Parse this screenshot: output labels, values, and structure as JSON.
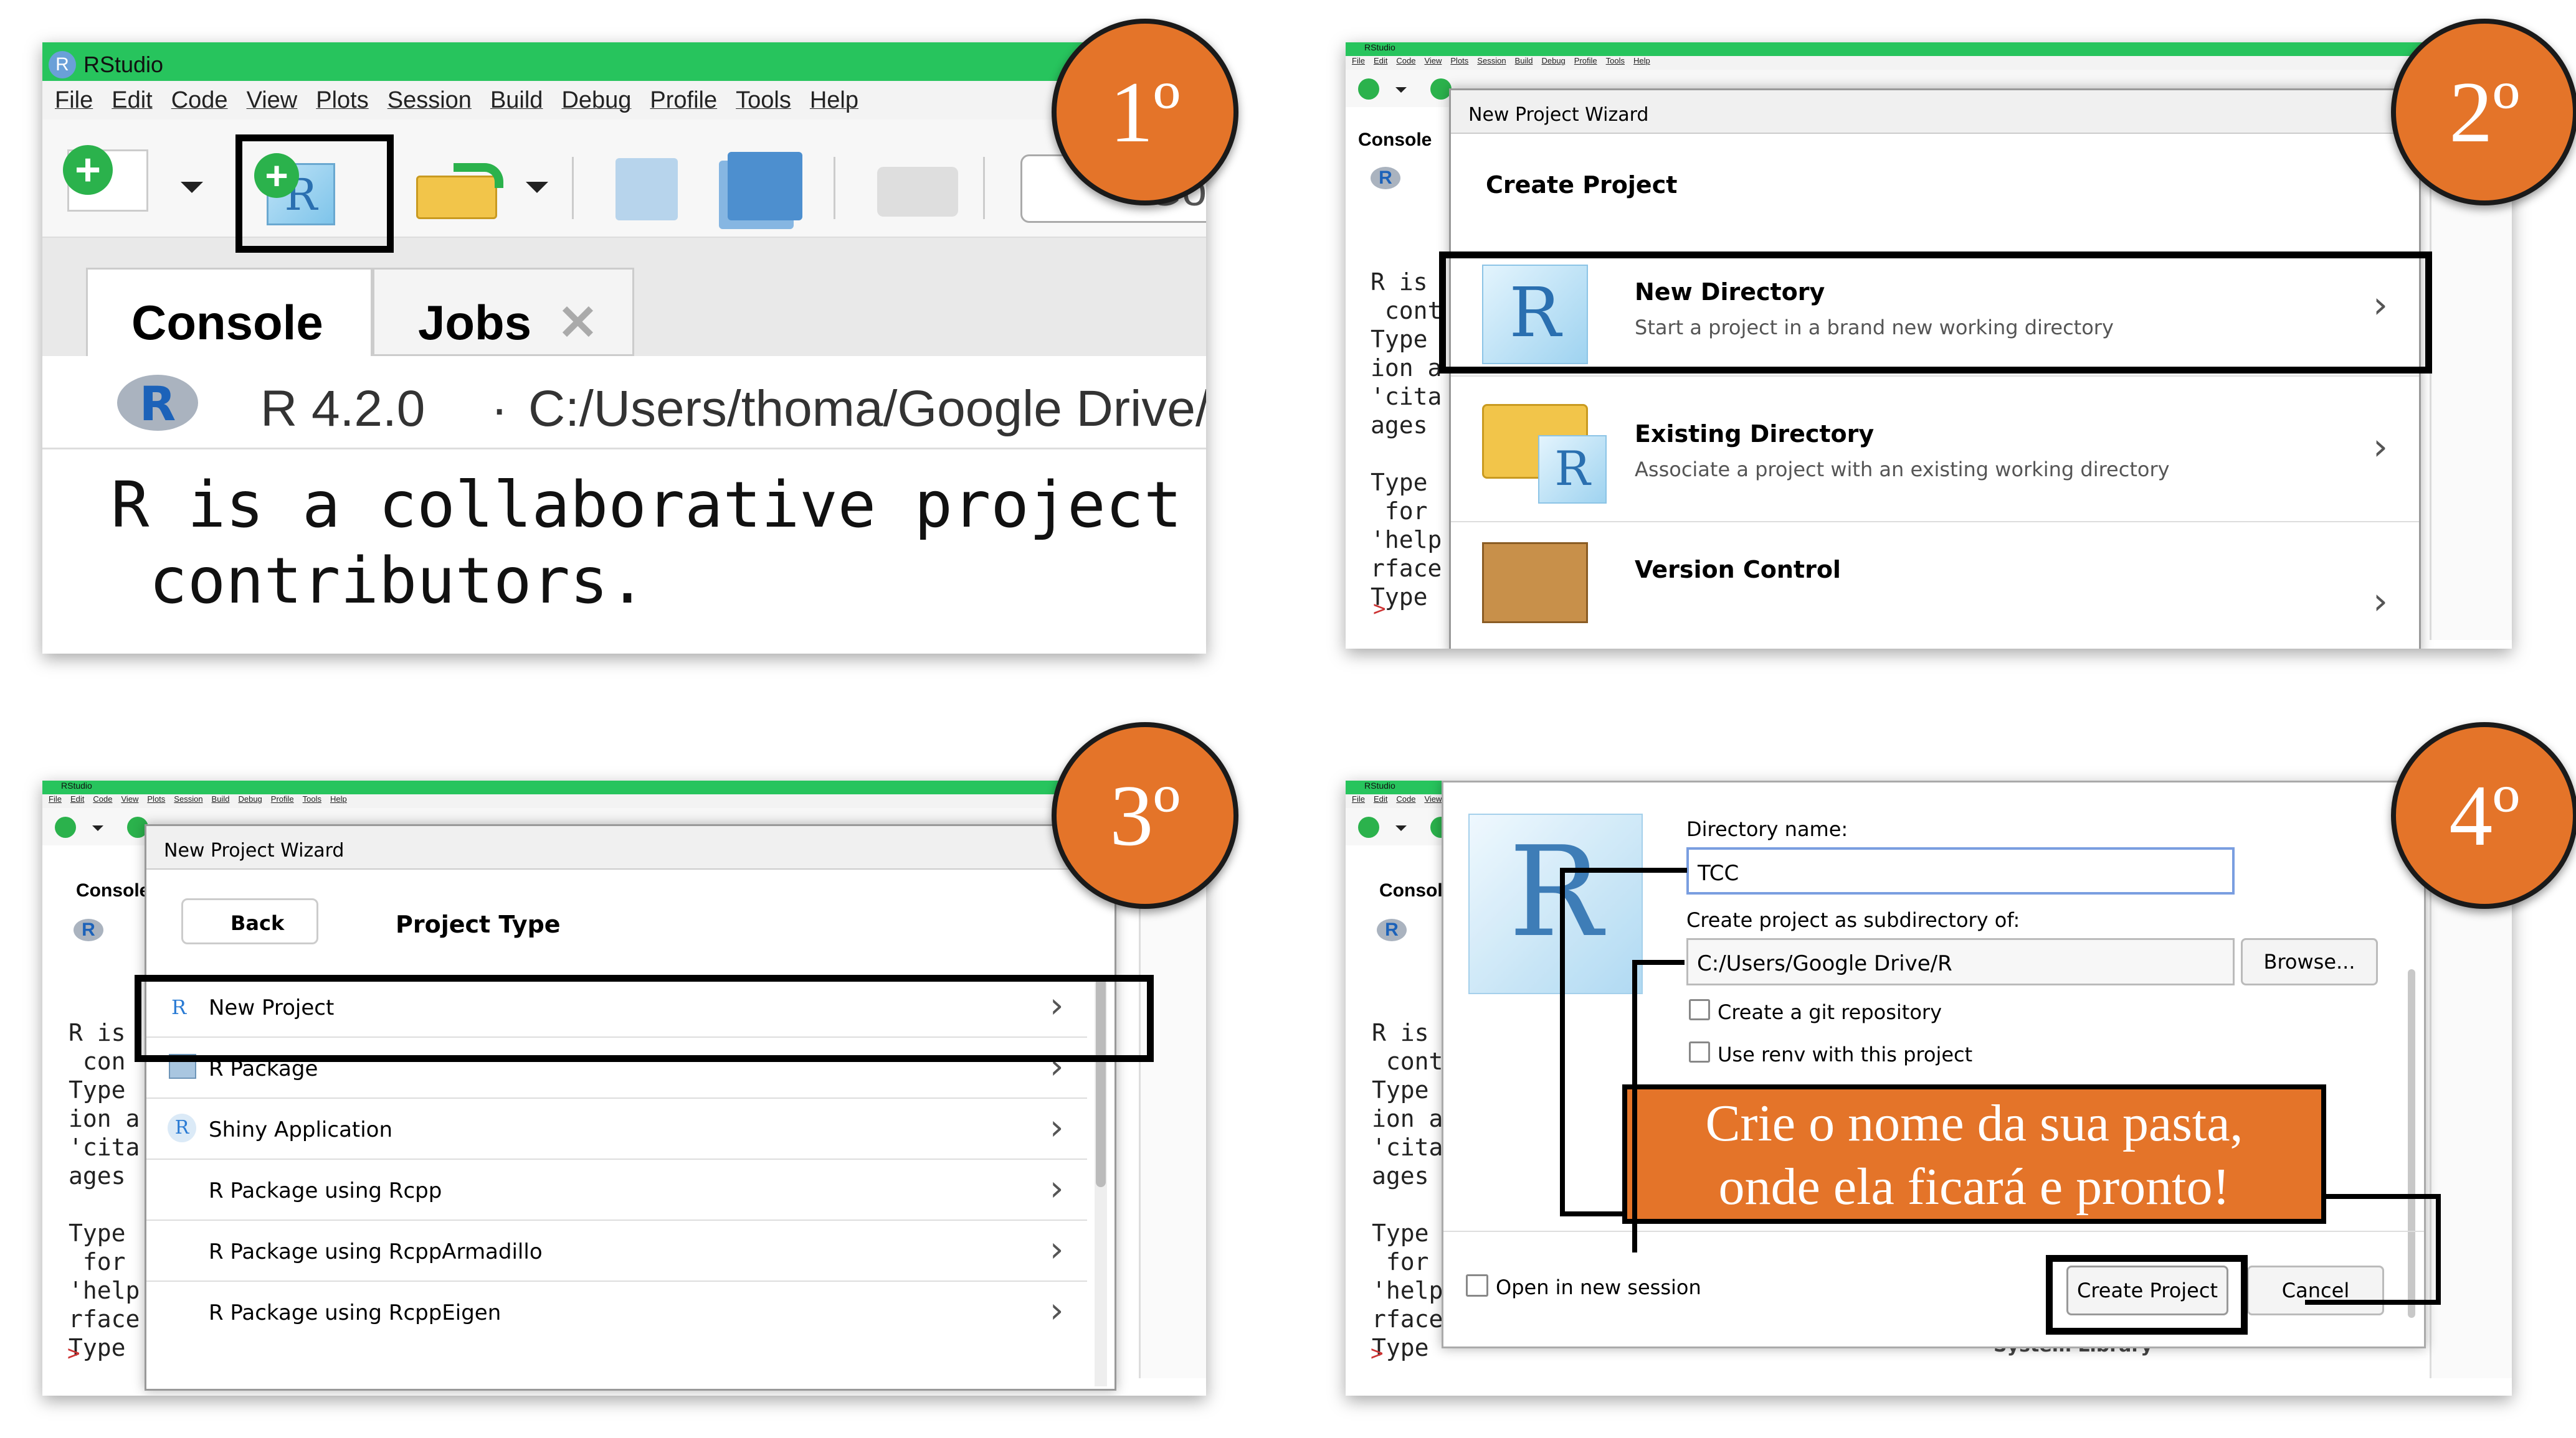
{
  "steps": [
    "1º",
    "2º",
    "3º",
    "4º"
  ],
  "app_title": "RStudio",
  "menu": [
    "File",
    "Edit",
    "Code",
    "View",
    "Plots",
    "Session",
    "Build",
    "Debug",
    "Profile",
    "Tools",
    "Help"
  ],
  "panel1": {
    "tabs": [
      "Console",
      "Jobs"
    ],
    "r_version": "R 4.2.0",
    "path": "C:/Users/thoma/Google Drive/",
    "console_line1": "R is a collaborative project",
    "console_line2": " contributors.",
    "go_fragment": "Go"
  },
  "console_bg_lines": [
    "R is",
    " cont",
    "Type",
    "ion a",
    "'cita",
    "ages",
    "",
    "Type",
    " for",
    "'help",
    "rface",
    "Type"
  ],
  "console_bg_lines_short": [
    "R is",
    " con",
    "Type",
    "ion a",
    "'cita",
    "ages",
    "",
    "Type",
    " for",
    "'help",
    "rface",
    "Type"
  ],
  "console_tab_short": "Console",
  "prompt": ">",
  "panel2": {
    "wizard_title": "New Project Wizard",
    "heading": "Create Project",
    "options": [
      {
        "title": "New Directory",
        "desc": "Start a project in a brand new working directory"
      },
      {
        "title": "Existing Directory",
        "desc": "Associate a project with an existing working directory"
      },
      {
        "title": "Version Control",
        "desc": ""
      }
    ]
  },
  "panel3": {
    "wizard_title": "New Project Wizard",
    "back": "Back",
    "heading": "Project Type",
    "types": [
      "New Project",
      "R Package",
      "Shiny Application",
      "R Package using Rcpp",
      "R Package using RcppArmadillo",
      "R Package using RcppEigen"
    ]
  },
  "panel4": {
    "dir_label": "Directory name:",
    "dir_value": "TCC",
    "sub_label": "Create project as subdirectory of:",
    "sub_value": "C:/Users/Google Drive/R",
    "browse": "Browse...",
    "git": "Create a git repository",
    "renv": "Use renv with this project",
    "open_new": "Open in new session",
    "create": "Create Project",
    "cancel": "Cancel",
    "callout_line1": "Crie o nome da sua pasta,",
    "callout_line2": "onde ela ficará e pronto!",
    "bg_fragment": "System Library"
  }
}
